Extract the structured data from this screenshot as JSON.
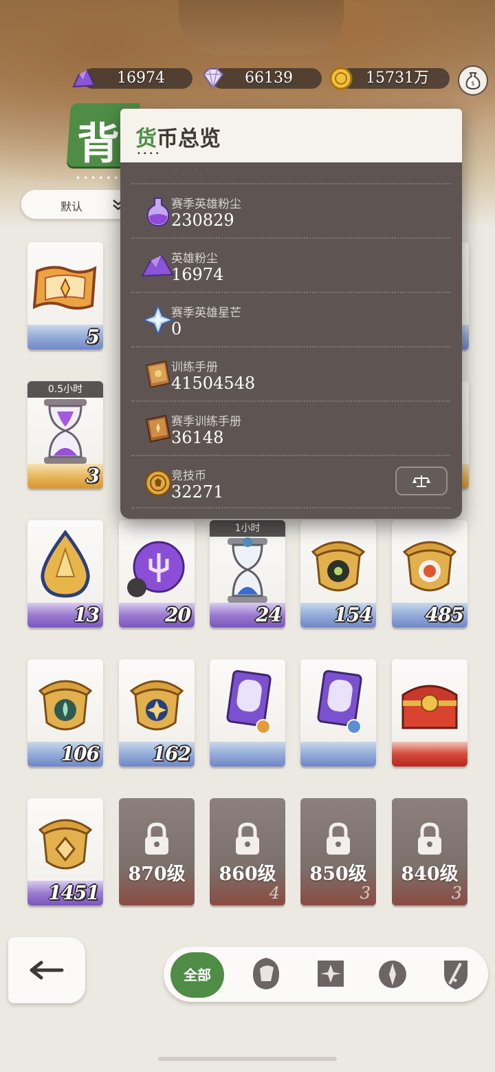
{
  "resources": [
    {
      "icon": "hero-dust-icon",
      "value": "16974"
    },
    {
      "icon": "diamond-icon",
      "value": "66139"
    },
    {
      "icon": "gold-coin-icon",
      "value": "15731万"
    }
  ],
  "header": {
    "title": "背",
    "sort_label": "默认"
  },
  "popup": {
    "title_first": "货",
    "title_rest": "币总览",
    "rows": [
      {
        "icon": "season-hero-dust-icon",
        "name": "赛季英雄粉尘",
        "value": "230829"
      },
      {
        "icon": "hero-dust-icon",
        "name": "英雄粉尘",
        "value": "16974"
      },
      {
        "icon": "season-hero-starlight-icon",
        "name": "赛季英雄星芒",
        "value": "0"
      },
      {
        "icon": "training-manual-icon",
        "name": "训练手册",
        "value": "41504548"
      },
      {
        "icon": "season-training-manual-icon",
        "name": "赛季训练手册",
        "value": "36148"
      },
      {
        "icon": "arena-coin-icon",
        "name": "竞技币",
        "value": "32271"
      }
    ]
  },
  "items": [
    {
      "icon": "scroll-ticket-icon",
      "count": "5",
      "band": "blue"
    },
    {
      "icon": "hourglass-purple-icon",
      "count": "3",
      "band": "gold",
      "timer": "0.5小时"
    },
    {
      "icon": "teardrop-gem-icon",
      "count": "13",
      "band": "purple"
    },
    {
      "icon": "purple-orb-icon",
      "count": "20",
      "band": "purple"
    },
    {
      "icon": "hourglass-blue-icon",
      "count": "24",
      "band": "purple",
      "timer": "1小时"
    },
    {
      "icon": "acorn-dark-icon",
      "count": "154",
      "band": "blue"
    },
    {
      "icon": "acorn-red-icon",
      "count": "485",
      "band": "blue"
    },
    {
      "icon": "acorn-green-icon",
      "count": "106",
      "band": "blue"
    },
    {
      "icon": "acorn-blue-icon",
      "count": "162",
      "band": "blue"
    },
    {
      "icon": "purple-card-gold-icon",
      "count": "",
      "band": "blue"
    },
    {
      "icon": "purple-card-blue-icon",
      "count": "",
      "band": "blue"
    },
    {
      "icon": "treasure-chest-icon",
      "count": "",
      "band": "red"
    },
    {
      "icon": "acorn-gold-icon",
      "count": "1451",
      "band": "purple"
    }
  ],
  "locked": [
    {
      "level": "870级",
      "count": ""
    },
    {
      "level": "860级",
      "count": "4"
    },
    {
      "level": "850级",
      "count": "3"
    },
    {
      "level": "840级",
      "count": "3"
    }
  ],
  "tabs": {
    "all_label": "全部"
  }
}
